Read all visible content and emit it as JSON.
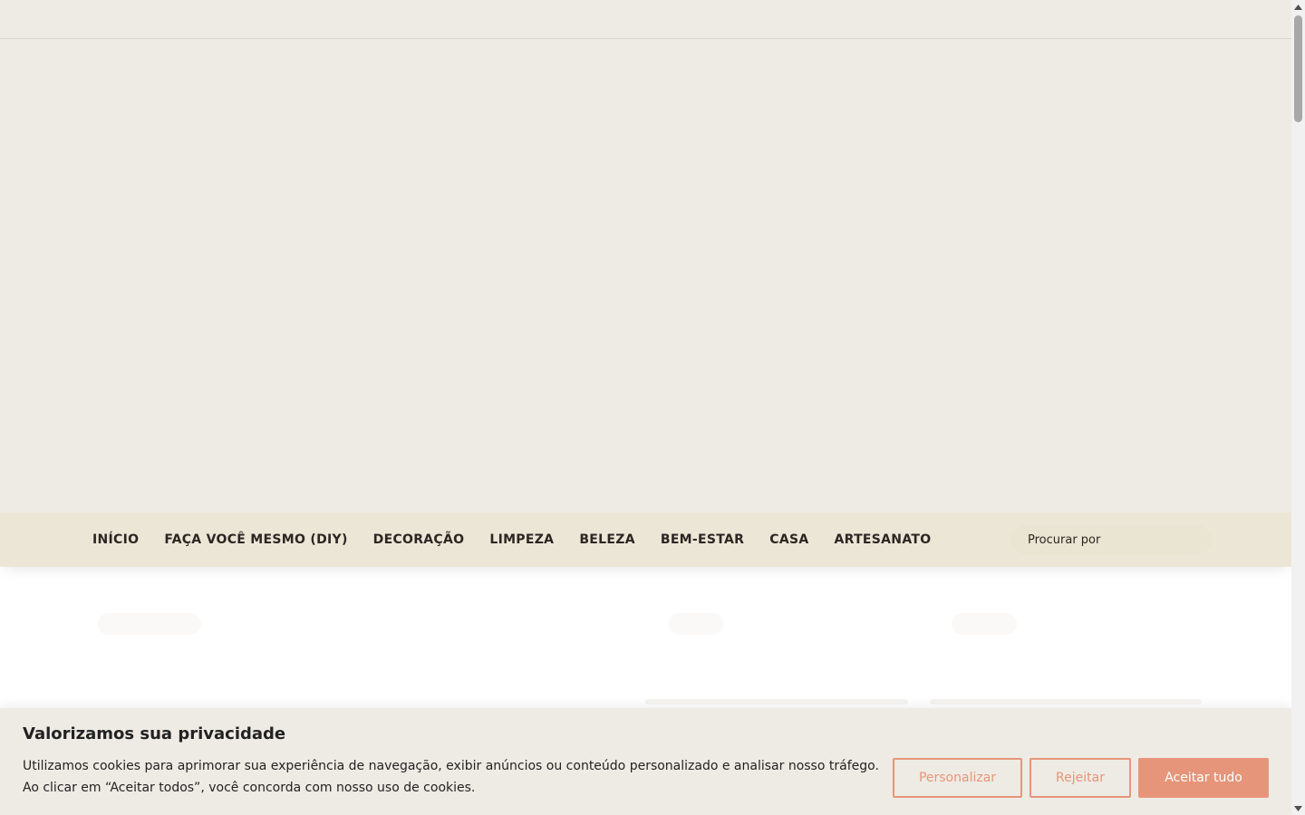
{
  "nav": {
    "items": [
      {
        "label": "INÍCIO"
      },
      {
        "label": "FAÇA VOCÊ MESMO (DIY)"
      },
      {
        "label": "DECORAÇÃO"
      },
      {
        "label": "LIMPEZA"
      },
      {
        "label": "BELEZA"
      },
      {
        "label": "BEM-ESTAR"
      },
      {
        "label": "CASA"
      },
      {
        "label": "ARTESANATO"
      }
    ],
    "search_placeholder": "Procurar por"
  },
  "cookie": {
    "title": "Valorizamos sua privacidade",
    "text_line1": "Utilizamos cookies para aprimorar sua experiência de navegação, exibir anúncios ou conteúdo personalizado e analisar nosso tráfego.",
    "text_line2": "Ao clicar em “Aceitar todos”, você concorda com nosso uso de cookies.",
    "customize_label": "Personalizar",
    "reject_label": "Rejeitar",
    "accept_label": "Aceitar tudo"
  },
  "colors": {
    "accent": "#e6957a",
    "header_bg": "#eeebe4",
    "nav_bg": "#ece6d6",
    "text": "#2b2622"
  }
}
